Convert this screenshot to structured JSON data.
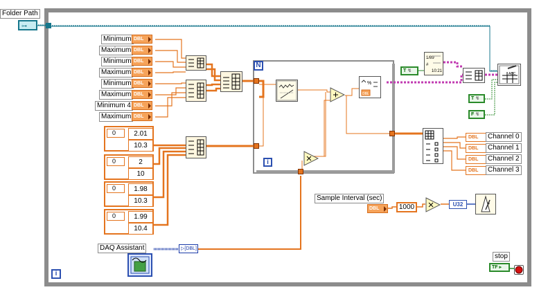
{
  "diagram": {
    "folder_path_label": "Folder Path",
    "mins_maxes": [
      "Minimum",
      "Maximum",
      "Minimum",
      "Maximum",
      "Minimum",
      "Maximum",
      "Minimum 4",
      "Maximum"
    ],
    "dbl_tag": "DBL",
    "array_controls": [
      {
        "index": "0",
        "values": [
          "2.01",
          "10.3"
        ]
      },
      {
        "index": "0",
        "values": [
          "2",
          "10"
        ]
      },
      {
        "index": "0",
        "values": [
          "1.98",
          "10.3"
        ]
      },
      {
        "index": "0",
        "values": [
          "1.99",
          "10.4"
        ]
      }
    ],
    "daq_assistant_label": "DAQ Assistant",
    "for_loop_N": "N",
    "for_loop_i": "i",
    "while_loop_i": "i",
    "channels": [
      "Channel 0",
      "Channel 1",
      "Channel 2",
      "Channel 3"
    ],
    "sample_interval_label": "Sample Interval (sec)",
    "sample_interval_const": "1000",
    "u32_tag": "U32",
    "stop_label": "stop",
    "tf_tag": "TF",
    "true_const": "T",
    "false_const": "F"
  }
}
